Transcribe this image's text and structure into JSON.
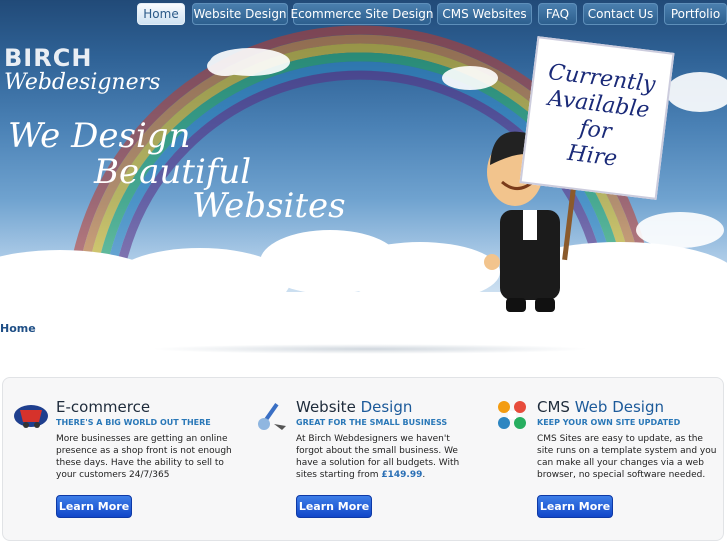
{
  "nav": {
    "items": [
      {
        "label": "Home",
        "active": true
      },
      {
        "label": "Website Design"
      },
      {
        "label": "Ecommerce Site Design"
      },
      {
        "label": "CMS Websites"
      },
      {
        "label": "FAQ"
      },
      {
        "label": "Contact Us"
      },
      {
        "label": "Portfolio"
      }
    ]
  },
  "brand": {
    "line1": "BIRCH",
    "line2": "Webdesigners"
  },
  "tagline": {
    "l1": "We Design",
    "l2": "Beautiful",
    "l3": "Websites"
  },
  "sign": {
    "l1": "Currently",
    "l2": "Available",
    "l3": "for",
    "l4": "Hire"
  },
  "breadcrumb": "Home",
  "features": [
    {
      "title": "E-commerce",
      "title_accent": "",
      "subtitle": "THERE'S A BIG WORLD OUT THERE",
      "body": "More businesses are getting an online presence as a shop front is not enough these days. Have the ability to sell to your customers 24/7/365",
      "button": "Learn More"
    },
    {
      "title": "Website ",
      "title_accent": "Design",
      "subtitle": "GREAT FOR THE SMALL BUSINESS",
      "body": "At Birch Webdesigners we haven't forgot about the small business. We have a solution for all budgets. With sites starting from ",
      "price": "£149.99",
      "body_end": ".",
      "button": "Learn More"
    },
    {
      "title": "CMS ",
      "title_accent": "Web Design",
      "subtitle": "KEEP YOUR OWN SITE UPDATED",
      "body": "CMS Sites are easy to update, as the site runs on a template system and you can make all your changes via a web browser, no special software needed.",
      "button": "Learn More"
    }
  ],
  "colors": {
    "nav_bg": "#2d5f8e",
    "accent": "#1c5a9a",
    "button": "#1146c9",
    "subtitle": "#2a78b8",
    "sign_text": "#1a2a78"
  }
}
